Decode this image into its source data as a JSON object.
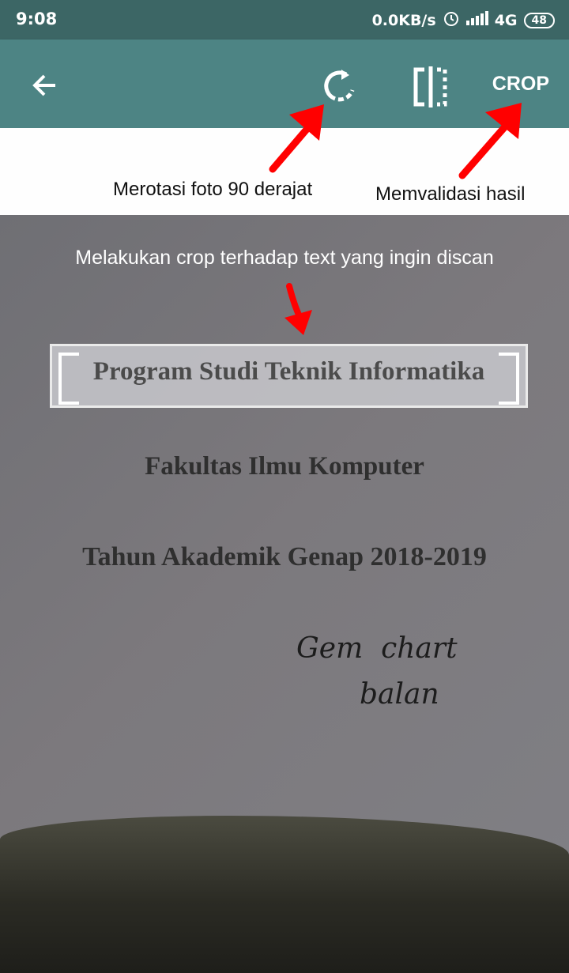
{
  "status_bar": {
    "time": "9:08",
    "speed": "0.0KB/s",
    "network": "4G",
    "battery": "48",
    "icons": [
      "alarm-icon",
      "signal-icon"
    ]
  },
  "toolbar": {
    "back_icon": "arrow-left-icon",
    "rotate_icon": "rotate-icon",
    "split_icon": "split-view-icon",
    "crop_label": "CROP"
  },
  "annotations": {
    "rotate_caption": "Merotasi foto 90 derajat",
    "validate_caption": "Memvalidasi hasil",
    "crop_hint": "Melakukan crop terhadap text yang ingin discan",
    "arrow_color": "#ff0000"
  },
  "document": {
    "selected_line": "Program Studi Teknik Informatika",
    "line2": "Fakultas Ilmu Komputer",
    "line3": "Tahun Akademik Genap 2018-2019",
    "handwriting": "Gem chart\nbalan"
  }
}
